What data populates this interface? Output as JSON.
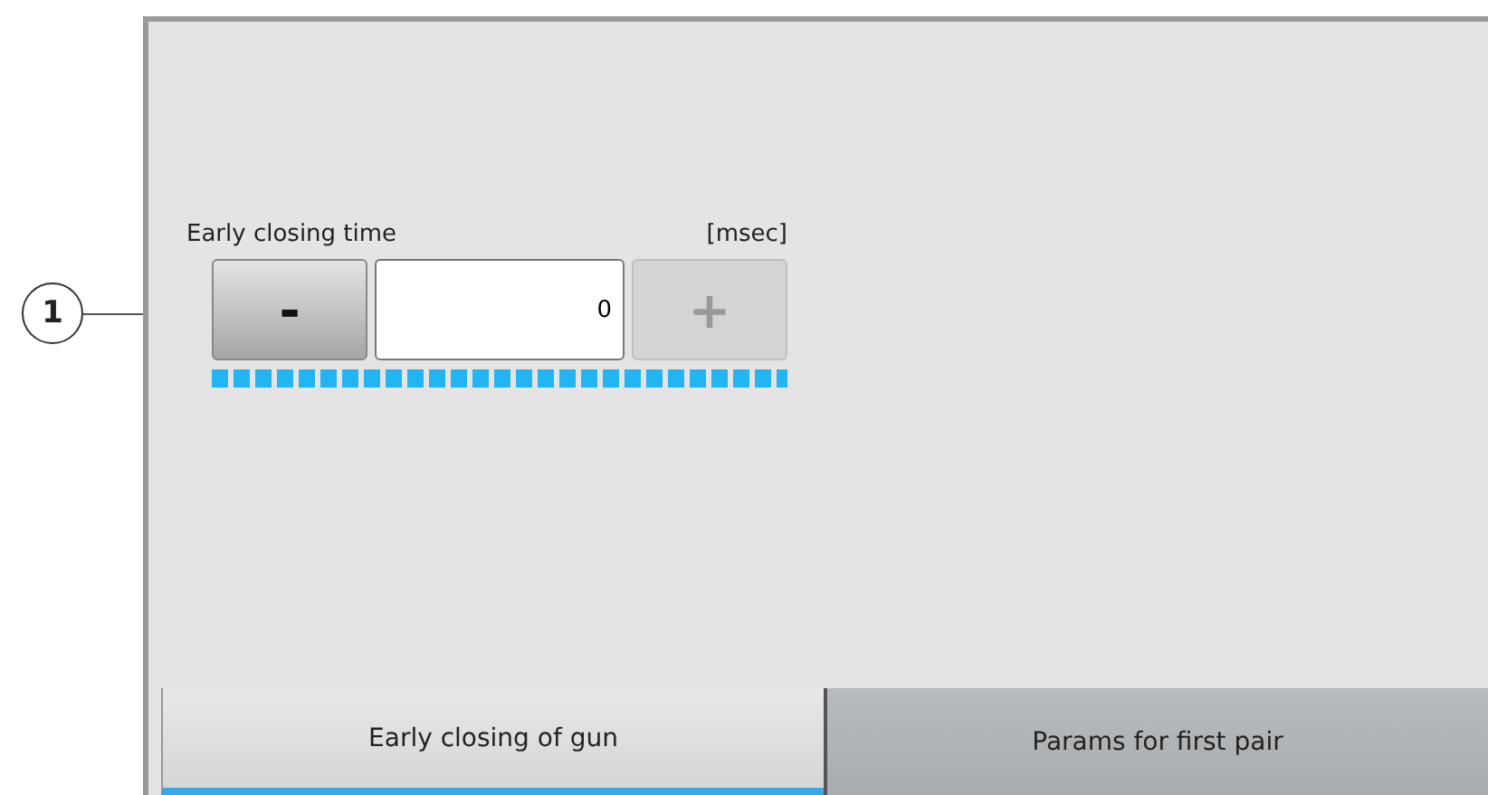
{
  "callout": {
    "number": "1"
  },
  "setting": {
    "label": "Early closing time",
    "unit": "[msec]",
    "value": "0",
    "minus": {
      "label": "-",
      "disabled": false
    },
    "plus": {
      "label": "+",
      "disabled": true
    }
  },
  "tabs": [
    {
      "label": "Early closing of gun",
      "selected": true
    },
    {
      "label": "Params for first pair",
      "selected": false
    }
  ]
}
